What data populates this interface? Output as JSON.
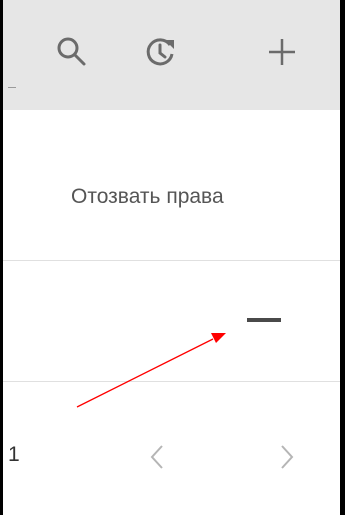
{
  "toolbar": {
    "buttons": [
      {
        "icon": "search-icon"
      },
      {
        "icon": "refresh-icon"
      },
      {
        "icon": "add-icon"
      }
    ]
  },
  "table": {
    "header": {
      "revoke_label": "Отозвать права"
    },
    "row": {
      "revoke_action": "remove-icon"
    }
  },
  "pagination": {
    "count": "1"
  },
  "annotation": {
    "arrow_color": "#ff0000"
  },
  "colors": {
    "toolbar_bg": "#e6e6e6",
    "icon": "#6b6b6b",
    "divider": "#e0e0e0"
  }
}
